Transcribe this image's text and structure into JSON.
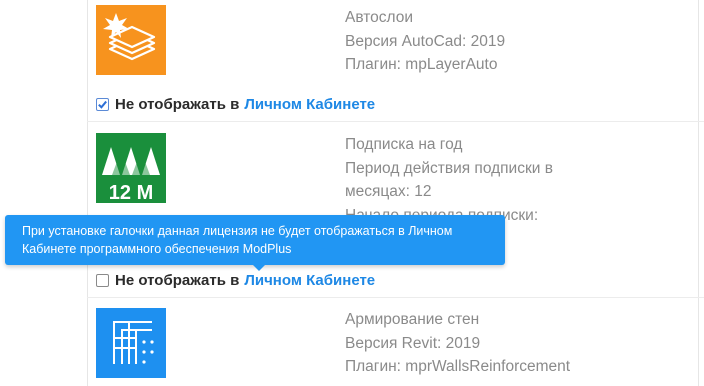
{
  "items": [
    {
      "icon": "layers-icon",
      "icon_bg": "#f7931e",
      "lines": [
        "Автослои",
        "Версия AutoCad: 2019",
        "Плагин: mpLayerAuto"
      ],
      "checkbox": {
        "checked": true,
        "prefix": "Не отображать в",
        "link": "Личном Кабинете"
      }
    },
    {
      "icon": "modplus-12m-icon",
      "icon_bg": "#1a8f3c",
      "icon_text": "12 M",
      "lines": [
        "Подписка на год",
        "Период действия подписки в месяцах: 12",
        "Начало периода подписки:"
      ],
      "checkbox": {
        "checked": false,
        "prefix": "Не отображать в",
        "link": "Личном Кабинете"
      }
    },
    {
      "icon": "wall-reinforcement-icon",
      "icon_bg": "#1e90f0",
      "lines": [
        "Армирование стен",
        "Версия Revit: 2019",
        "Плагин: mprWallsReinforcement"
      ]
    }
  ],
  "tooltip": {
    "text": "При установке галочки данная лицензия не будет отображаться в Личном Кабинете программного обеспечения ModPlus"
  },
  "colors": {
    "link": "#1e88e5",
    "tooltip_bg": "#2196f3",
    "text_muted": "#8a8a8a"
  }
}
